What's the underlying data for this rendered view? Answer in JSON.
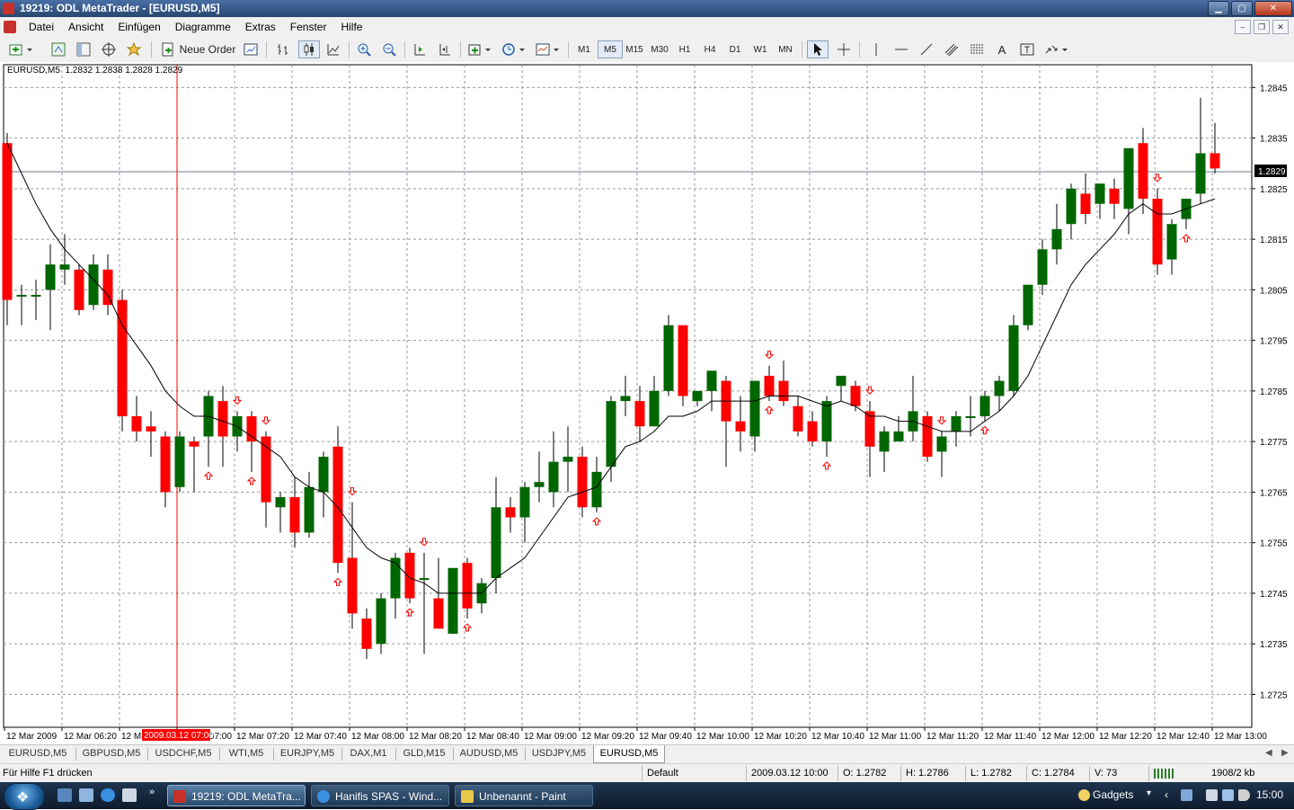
{
  "window": {
    "title": "19219: ODL MetaTrader - [EURUSD,M5]",
    "min": "▁",
    "max": "▢",
    "close": "✕"
  },
  "menu": [
    "Datei",
    "Ansicht",
    "Einfügen",
    "Diagramme",
    "Extras",
    "Fenster",
    "Hilfe"
  ],
  "toolbar": {
    "new_order": "Neue Order",
    "periods": [
      "M1",
      "M5",
      "M15",
      "M30",
      "H1",
      "H4",
      "D1",
      "W1",
      "MN"
    ],
    "active_period": "M5",
    "text_tool": "A"
  },
  "chart": {
    "info_label": "EURUSD,M5",
    "ohlc_text": "1.2832 1.2838 1.2828 1.2829",
    "current_price": "1.2829",
    "cursor_label": "2009.03.12 07:00",
    "price_ticks": [
      "1.2845",
      "1.2835",
      "1.2825",
      "1.2815",
      "1.2805",
      "1.2795",
      "1.2785",
      "1.2775",
      "1.2765",
      "1.2755",
      "1.2745",
      "1.2735",
      "1.2725"
    ],
    "time_ticks": [
      "12 Mar 2009",
      "12 Mar 06:20",
      "12 Mar 06:40",
      "12 Mar 07:00",
      "12 Mar 07:20",
      "12 Mar 07:40",
      "12 Mar 08:00",
      "12 Mar 08:20",
      "12 Mar 08:40",
      "12 Mar 09:00",
      "12 Mar 09:20",
      "12 Mar 09:40",
      "12 Mar 10:00",
      "12 Mar 10:20",
      "12 Mar 10:40",
      "12 Mar 11:00",
      "12 Mar 11:20",
      "12 Mar 11:40",
      "12 Mar 12:00",
      "12 Mar 12:20",
      "12 Mar 12:40",
      "12 Mar 13:00"
    ],
    "colors": {
      "bull": "#006600",
      "bear": "#ff0000",
      "ma": "#000000",
      "grid": "#9a9a9a",
      "arrow": "#ff0000",
      "bid_line": "#6b7a8f"
    }
  },
  "chart_data": {
    "type": "candlestick",
    "symbol": "EURUSD",
    "timeframe": "M5",
    "ylim": [
      1.27185,
      1.28495
    ],
    "candles": [
      {
        "o": 1.2834,
        "h": 1.2836,
        "l": 1.2798,
        "c": 1.2803
      },
      {
        "o": 1.2804,
        "h": 1.2806,
        "l": 1.2798,
        "c": 1.2804
      },
      {
        "o": 1.2804,
        "h": 1.2807,
        "l": 1.2799,
        "c": 1.2804
      },
      {
        "o": 1.2805,
        "h": 1.2814,
        "l": 1.2797,
        "c": 1.281
      },
      {
        "o": 1.2809,
        "h": 1.2816,
        "l": 1.2806,
        "c": 1.281
      },
      {
        "o": 1.2809,
        "h": 1.281,
        "l": 1.28,
        "c": 1.2801
      },
      {
        "o": 1.2802,
        "h": 1.2812,
        "l": 1.2801,
        "c": 1.281
      },
      {
        "o": 1.2809,
        "h": 1.2812,
        "l": 1.28,
        "c": 1.2802
      },
      {
        "o": 1.2803,
        "h": 1.2805,
        "l": 1.2777,
        "c": 1.278
      },
      {
        "o": 1.278,
        "h": 1.2784,
        "l": 1.2775,
        "c": 1.2777
      },
      {
        "o": 1.2778,
        "h": 1.2781,
        "l": 1.2772,
        "c": 1.2777
      },
      {
        "o": 1.2776,
        "h": 1.2777,
        "l": 1.2762,
        "c": 1.2765
      },
      {
        "o": 1.2766,
        "h": 1.2777,
        "l": 1.2765,
        "c": 1.2776
      },
      {
        "o": 1.2775,
        "h": 1.2776,
        "l": 1.2765,
        "c": 1.2774
      },
      {
        "o": 1.2776,
        "h": 1.2785,
        "l": 1.277,
        "c": 1.2784
      },
      {
        "o": 1.2783,
        "h": 1.2786,
        "l": 1.277,
        "c": 1.2776
      },
      {
        "o": 1.2776,
        "h": 1.2781,
        "l": 1.2773,
        "c": 1.278
      },
      {
        "o": 1.278,
        "h": 1.2781,
        "l": 1.2769,
        "c": 1.2775
      },
      {
        "o": 1.2776,
        "h": 1.2777,
        "l": 1.2758,
        "c": 1.2763
      },
      {
        "o": 1.2762,
        "h": 1.2765,
        "l": 1.2757,
        "c": 1.2764
      },
      {
        "o": 1.2764,
        "h": 1.2768,
        "l": 1.2754,
        "c": 1.2757
      },
      {
        "o": 1.2757,
        "h": 1.2769,
        "l": 1.2756,
        "c": 1.2766
      },
      {
        "o": 1.2765,
        "h": 1.2773,
        "l": 1.276,
        "c": 1.2772
      },
      {
        "o": 1.2774,
        "h": 1.2778,
        "l": 1.2749,
        "c": 1.2751
      },
      {
        "o": 1.2752,
        "h": 1.2763,
        "l": 1.2738,
        "c": 1.2741
      },
      {
        "o": 1.274,
        "h": 1.2742,
        "l": 1.2732,
        "c": 1.2734
      },
      {
        "o": 1.2735,
        "h": 1.2745,
        "l": 1.2733,
        "c": 1.2744
      },
      {
        "o": 1.2744,
        "h": 1.2753,
        "l": 1.274,
        "c": 1.2752
      },
      {
        "o": 1.2753,
        "h": 1.2754,
        "l": 1.2743,
        "c": 1.2744
      },
      {
        "o": 1.2748,
        "h": 1.2753,
        "l": 1.2733,
        "c": 1.2748
      },
      {
        "o": 1.2744,
        "h": 1.2752,
        "l": 1.274,
        "c": 1.2738
      },
      {
        "o": 1.2737,
        "h": 1.275,
        "l": 1.2737,
        "c": 1.275
      },
      {
        "o": 1.2751,
        "h": 1.2752,
        "l": 1.274,
        "c": 1.2742
      },
      {
        "o": 1.2743,
        "h": 1.2748,
        "l": 1.2741,
        "c": 1.2747
      },
      {
        "o": 1.2748,
        "h": 1.2768,
        "l": 1.2745,
        "c": 1.2762
      },
      {
        "o": 1.2762,
        "h": 1.2764,
        "l": 1.2757,
        "c": 1.276
      },
      {
        "o": 1.276,
        "h": 1.2767,
        "l": 1.2755,
        "c": 1.2766
      },
      {
        "o": 1.2766,
        "h": 1.2773,
        "l": 1.2763,
        "c": 1.2767
      },
      {
        "o": 1.2765,
        "h": 1.2777,
        "l": 1.2762,
        "c": 1.2771
      },
      {
        "o": 1.2771,
        "h": 1.2778,
        "l": 1.2765,
        "c": 1.2772
      },
      {
        "o": 1.2772,
        "h": 1.2774,
        "l": 1.276,
        "c": 1.2762
      },
      {
        "o": 1.2762,
        "h": 1.2772,
        "l": 1.2761,
        "c": 1.2769
      },
      {
        "o": 1.277,
        "h": 1.2784,
        "l": 1.2767,
        "c": 1.2783
      },
      {
        "o": 1.2783,
        "h": 1.2788,
        "l": 1.278,
        "c": 1.2784
      },
      {
        "o": 1.2783,
        "h": 1.2786,
        "l": 1.2775,
        "c": 1.2778
      },
      {
        "o": 1.2778,
        "h": 1.2788,
        "l": 1.2778,
        "c": 1.2785
      },
      {
        "o": 1.2785,
        "h": 1.28,
        "l": 1.2784,
        "c": 1.2798
      },
      {
        "o": 1.2798,
        "h": 1.2798,
        "l": 1.2782,
        "c": 1.2784
      },
      {
        "o": 1.2783,
        "h": 1.2785,
        "l": 1.2782,
        "c": 1.2785
      },
      {
        "o": 1.2785,
        "h": 1.2788,
        "l": 1.2781,
        "c": 1.2789
      },
      {
        "o": 1.2787,
        "h": 1.2788,
        "l": 1.277,
        "c": 1.2779
      },
      {
        "o": 1.2779,
        "h": 1.2784,
        "l": 1.2773,
        "c": 1.2777
      },
      {
        "o": 1.2776,
        "h": 1.2787,
        "l": 1.2773,
        "c": 1.2787
      },
      {
        "o": 1.2788,
        "h": 1.279,
        "l": 1.2783,
        "c": 1.2784
      },
      {
        "o": 1.2787,
        "h": 1.2791,
        "l": 1.2782,
        "c": 1.2783
      },
      {
        "o": 1.2782,
        "h": 1.2784,
        "l": 1.2776,
        "c": 1.2777
      },
      {
        "o": 1.2779,
        "h": 1.2781,
        "l": 1.2774,
        "c": 1.2775
      },
      {
        "o": 1.2775,
        "h": 1.2784,
        "l": 1.2772,
        "c": 1.2783
      },
      {
        "o": 1.2786,
        "h": 1.2788,
        "l": 1.2783,
        "c": 1.2788
      },
      {
        "o": 1.2786,
        "h": 1.2787,
        "l": 1.2781,
        "c": 1.2782
      },
      {
        "o": 1.2781,
        "h": 1.2783,
        "l": 1.2768,
        "c": 1.2774
      },
      {
        "o": 1.2773,
        "h": 1.2778,
        "l": 1.2769,
        "c": 1.2777
      },
      {
        "o": 1.2775,
        "h": 1.278,
        "l": 1.2775,
        "c": 1.2777
      },
      {
        "o": 1.2777,
        "h": 1.2788,
        "l": 1.2775,
        "c": 1.2781
      },
      {
        "o": 1.278,
        "h": 1.2781,
        "l": 1.2771,
        "c": 1.2772
      },
      {
        "o": 1.2773,
        "h": 1.2777,
        "l": 1.2768,
        "c": 1.2776
      },
      {
        "o": 1.2777,
        "h": 1.2781,
        "l": 1.2774,
        "c": 1.278
      },
      {
        "o": 1.278,
        "h": 1.2784,
        "l": 1.2776,
        "c": 1.278
      },
      {
        "o": 1.278,
        "h": 1.2785,
        "l": 1.2779,
        "c": 1.2784
      },
      {
        "o": 1.2784,
        "h": 1.2788,
        "l": 1.2781,
        "c": 1.2787
      },
      {
        "o": 1.2785,
        "h": 1.28,
        "l": 1.2784,
        "c": 1.2798
      },
      {
        "o": 1.2798,
        "h": 1.2806,
        "l": 1.2797,
        "c": 1.2806
      },
      {
        "o": 1.2806,
        "h": 1.2815,
        "l": 1.2804,
        "c": 1.2813
      },
      {
        "o": 1.2813,
        "h": 1.2822,
        "l": 1.281,
        "c": 1.2817
      },
      {
        "o": 1.2818,
        "h": 1.2826,
        "l": 1.2815,
        "c": 1.2825
      },
      {
        "o": 1.2824,
        "h": 1.2828,
        "l": 1.2818,
        "c": 1.282
      },
      {
        "o": 1.2822,
        "h": 1.2826,
        "l": 1.2819,
        "c": 1.2826
      },
      {
        "o": 1.2825,
        "h": 1.2827,
        "l": 1.2819,
        "c": 1.2822
      },
      {
        "o": 1.2821,
        "h": 1.2833,
        "l": 1.2816,
        "c": 1.2833
      },
      {
        "o": 1.2834,
        "h": 1.2837,
        "l": 1.282,
        "c": 1.2823
      },
      {
        "o": 1.2823,
        "h": 1.2825,
        "l": 1.2808,
        "c": 1.281
      },
      {
        "o": 1.2811,
        "h": 1.2819,
        "l": 1.2808,
        "c": 1.2818
      },
      {
        "o": 1.2819,
        "h": 1.2823,
        "l": 1.2817,
        "c": 1.2823
      },
      {
        "o": 1.2824,
        "h": 1.2843,
        "l": 1.2822,
        "c": 1.2832
      },
      {
        "o": 1.2832,
        "h": 1.2838,
        "l": 1.2828,
        "c": 1.2829
      }
    ],
    "moving_average": [
      1.2834,
      1.2828,
      1.2822,
      1.2817,
      1.2813,
      1.281,
      1.2807,
      1.2804,
      1.2798,
      1.2794,
      1.279,
      1.2785,
      1.2782,
      1.278,
      1.278,
      1.2779,
      1.2778,
      1.2776,
      1.2774,
      1.2772,
      1.2768,
      1.2766,
      1.2765,
      1.2762,
      1.2758,
      1.2754,
      1.2752,
      1.2751,
      1.2748,
      1.2747,
      1.2745,
      1.2745,
      1.2745,
      1.2745,
      1.2748,
      1.275,
      1.2752,
      1.2756,
      1.276,
      1.2764,
      1.2765,
      1.2766,
      1.277,
      1.2774,
      1.2775,
      1.2777,
      1.278,
      1.278,
      1.2781,
      1.2783,
      1.2783,
      1.2783,
      1.2783,
      1.2784,
      1.2784,
      1.2784,
      1.2783,
      1.2782,
      1.2783,
      1.2782,
      1.278,
      1.278,
      1.2779,
      1.2779,
      1.2778,
      1.2777,
      1.2777,
      1.2777,
      1.2779,
      1.2781,
      1.2784,
      1.2788,
      1.2794,
      1.28,
      1.2806,
      1.281,
      1.2813,
      1.2816,
      1.282,
      1.2822,
      1.282,
      1.282,
      1.2821,
      1.2822,
      1.2823
    ]
  },
  "tabs": [
    "EURUSD,M5",
    "GBPUSD,M5",
    "USDCHF,M5",
    "WTI,M5",
    "EURJPY,M5",
    "DAX,M1",
    "GLD,M15",
    "AUDUSD,M5",
    "USDJPY,M5",
    "EURUSD,M5"
  ],
  "status": {
    "help": "Für Hilfe F1 drücken",
    "profile": "Default",
    "time": "2009.03.12 10:00",
    "open": "O: 1.2782",
    "high": "H: 1.2786",
    "low": "L: 1.2782",
    "close": "C: 1.2784",
    "volume": "V: 73",
    "traffic": "1908/2 kb"
  },
  "taskbar": {
    "tasks": [
      "19219: ODL MetaTra...",
      "Hanifis SPAS - Wind...",
      "Unbenannt - Paint"
    ],
    "gadgets": "Gadgets",
    "clock": "15:00"
  }
}
